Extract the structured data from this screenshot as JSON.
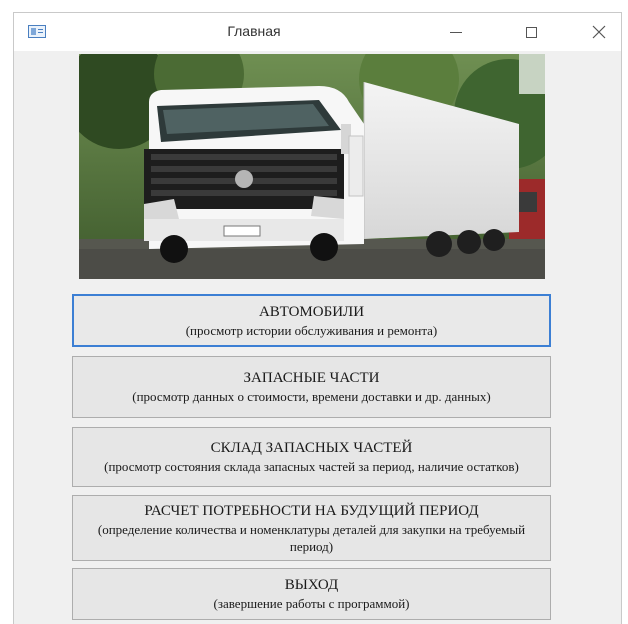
{
  "window": {
    "title": "Главная",
    "icons": {
      "app": "access-form-icon",
      "minimize": "minimize-icon",
      "maximize": "maximize-icon",
      "close": "close-icon"
    }
  },
  "photo": {
    "subject": "white-volvo-truck-with-trailer"
  },
  "buttons": [
    {
      "title": "АВТОМОБИЛИ",
      "subtitle": "(просмотр истории обслуживания и ремонта)"
    },
    {
      "title": "ЗАПАСНЫЕ ЧАСТИ",
      "subtitle": "(просмотр данных о стоимости,  времени доставки и др. данных)"
    },
    {
      "title": "СКЛАД ЗАПАСНЫХ ЧАСТЕЙ",
      "subtitle": "(просмотр состояния склада запасных частей за период, наличие остатков)"
    },
    {
      "title": "РАСЧЕТ ПОТРЕБНОСТИ НА БУДУЩИЙ ПЕРИОД",
      "subtitle": "(определение количества и номенклатуры деталей для закупки на требуемый период)"
    },
    {
      "title": "ВЫХОД",
      "subtitle": "(завершение работы с программой)"
    }
  ],
  "colors": {
    "focus": "#3c7fd4",
    "button_bg": "#e6e6e6",
    "window_bg": "#f0f0f0"
  }
}
